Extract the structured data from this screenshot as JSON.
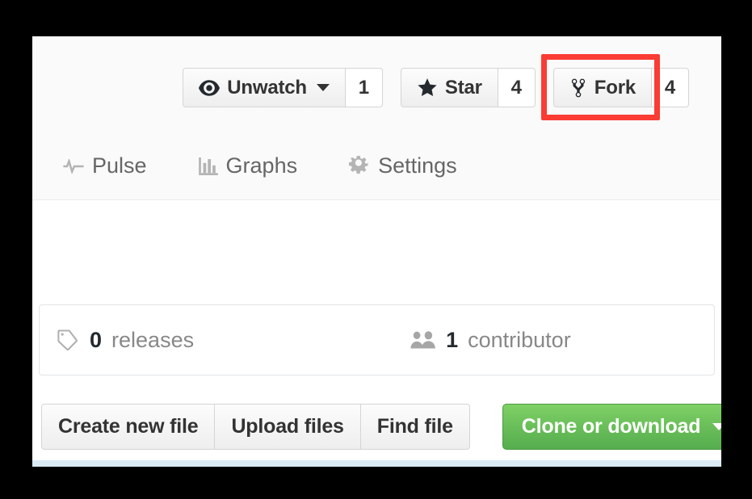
{
  "repo_actions": {
    "watch": {
      "label": "Unwatch",
      "icon": "eye-icon",
      "count": "1",
      "has_dropdown": true
    },
    "star": {
      "label": "Star",
      "icon": "star-icon",
      "count": "4",
      "has_dropdown": false
    },
    "fork": {
      "label": "Fork",
      "icon": "repo-forked-icon",
      "count": "4",
      "has_dropdown": false,
      "highlighted": true,
      "highlight_color": "#fa3c34"
    }
  },
  "repo_nav": {
    "items": [
      {
        "label": "Pulse",
        "icon": "pulse-icon"
      },
      {
        "label": "Graphs",
        "icon": "graph-icon"
      },
      {
        "label": "Settings",
        "icon": "gear-icon"
      }
    ]
  },
  "numbers_summary": {
    "releases": {
      "count": "0",
      "label": "releases",
      "icon": "tag-icon"
    },
    "contributors": {
      "count": "1",
      "label": "contributor",
      "icon": "organization-icon"
    }
  },
  "file_actions": {
    "buttons": [
      {
        "label": "Create new file"
      },
      {
        "label": "Upload files"
      },
      {
        "label": "Find file"
      }
    ],
    "clone": {
      "label": "Clone or download",
      "has_dropdown": true,
      "color": "#55ad4e"
    }
  },
  "colors": {
    "page_background": "#000000",
    "panel_background": "#ffffff",
    "header_background": "#fafafa",
    "border": "#e1e4e8",
    "text_muted": "#888888",
    "text_dark": "#24292e",
    "green_button": "#55ad4e",
    "highlight_red": "#fa3c34",
    "bottom_strip": "#dbeaf5"
  }
}
